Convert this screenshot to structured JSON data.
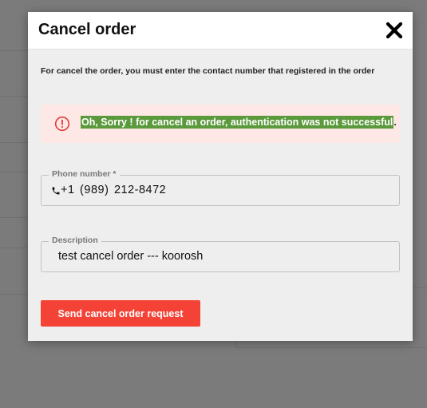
{
  "modal": {
    "title": "Cancel order",
    "instructions": "For cancel the order, you must enter the contact number that registered in the order",
    "alert": {
      "message": "Oh, Sorry ! for cancel an order, authentication was not successful",
      "trailing": ".",
      "icon": "exclamation-circle-icon",
      "color": "#e53935"
    },
    "phone": {
      "label": "Phone number *",
      "value": "+1 (989) 212-8472",
      "icon": "phone-icon"
    },
    "description": {
      "label": "Description",
      "value": "test cancel order --- koorosh"
    },
    "submit_label": "Send cancel order request",
    "colors": {
      "accent": "#f44336",
      "selection": "#5b9a3c",
      "alert_bg": "#fde8e6"
    }
  }
}
